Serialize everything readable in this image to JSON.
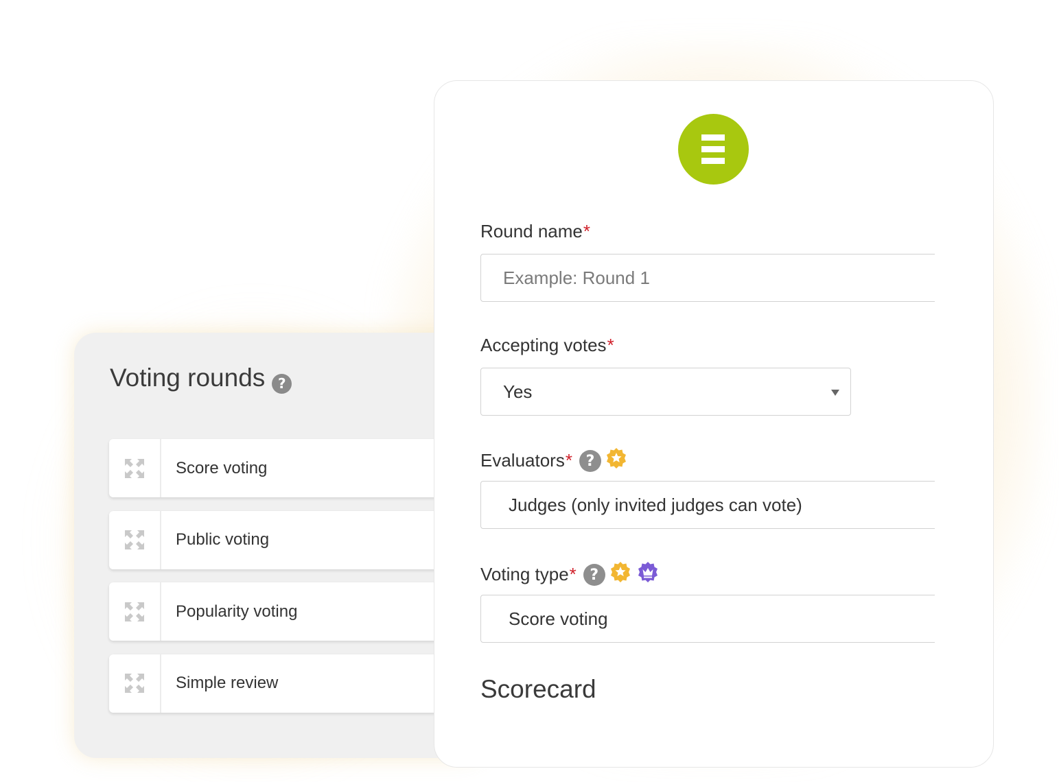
{
  "rounds_panel": {
    "title": "Voting rounds",
    "help_icon": "question-circle-icon",
    "items": [
      {
        "label": "Score voting",
        "icon": "drag-arrows-icon"
      },
      {
        "label": "Public voting",
        "icon": "drag-arrows-icon"
      },
      {
        "label": "Popularity voting",
        "icon": "drag-arrows-icon"
      },
      {
        "label": "Simple review",
        "icon": "drag-arrows-icon"
      }
    ]
  },
  "form": {
    "logo_icon": "brand-logo-icon",
    "logo_color": "#a8c80f",
    "round_name": {
      "label": "Round name",
      "required_mark": "*",
      "placeholder": "Example: Round 1",
      "value": ""
    },
    "accepting_votes": {
      "label": "Accepting votes",
      "required_mark": "*",
      "value": "Yes",
      "options": [
        "Yes"
      ]
    },
    "evaluators": {
      "label": "Evaluators",
      "required_mark": "*",
      "icons": [
        "question-circle-icon",
        "gold-star-badge-icon"
      ],
      "value": "Judges (only invited judges can vote)"
    },
    "voting_type": {
      "label": "Voting type",
      "required_mark": "*",
      "icons": [
        "question-circle-icon",
        "gold-star-badge-icon",
        "purple-crown-badge-icon"
      ],
      "value": "Score voting"
    },
    "scorecard": {
      "title": "Scorecard"
    }
  },
  "colors": {
    "required": "#d0202a",
    "gold_badge": "#f2b632",
    "purple_badge": "#7b5bd6",
    "rounds_panel_bg": "#f0f0f0"
  }
}
